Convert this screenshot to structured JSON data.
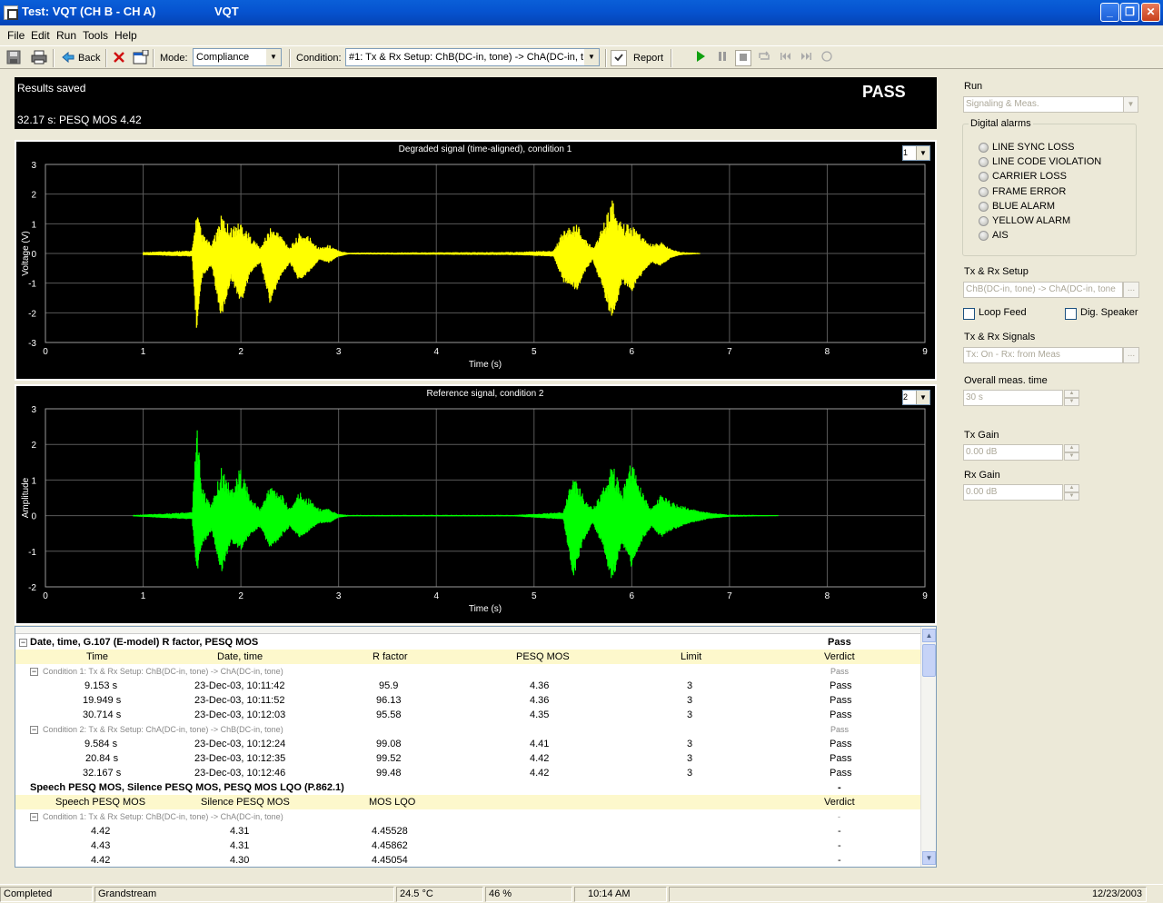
{
  "window": {
    "title": "Test: VQT (CH B - CH A)",
    "subtitle": "VQT",
    "min_glyph": "_",
    "restore_glyph": "❐",
    "close_glyph": "✕"
  },
  "menu": [
    "File",
    "Edit",
    "Run",
    "Tools",
    "Help"
  ],
  "toolbar": {
    "back_label": "Back",
    "mode_label": "Mode:",
    "mode_value": "Compliance",
    "condition_label": "Condition:",
    "condition_value": "#1: Tx & Rx Setup: ChB(DC-in, tone) -> ChA(DC-in, t",
    "report_label": "Report",
    "icons": [
      "save-icon",
      "print-icon",
      "back-arrow-icon",
      "delete-icon",
      "properties-icon",
      "check-icon",
      "play-icon",
      "pause-icon",
      "stop-icon",
      "loop-icon",
      "rewind-icon",
      "fast-forward-icon",
      "record-icon"
    ]
  },
  "status": {
    "message": "Results saved",
    "measurement": "32.17 s:  PESQ MOS  4.42",
    "verdict": "PASS"
  },
  "chart_data": [
    {
      "type": "line",
      "title": "Degraded signal (time-aligned), condition 1",
      "xlabel": "Time (s)",
      "ylabel": "Voltage (V)",
      "xlim": [
        0,
        9
      ],
      "ylim": [
        -3,
        3
      ],
      "x_ticks": [
        "0",
        "1",
        "2",
        "3",
        "4",
        "5",
        "6",
        "7",
        "8",
        "9"
      ],
      "y_ticks": [
        "3",
        "2",
        "1",
        "0",
        "-1",
        "-2",
        "-3"
      ],
      "color": "#ffff00",
      "selector": "1",
      "envelope": {
        "x": [
          1.0,
          1.5,
          1.55,
          1.6,
          1.7,
          1.8,
          1.9,
          2.0,
          2.1,
          2.2,
          2.3,
          2.4,
          2.5,
          2.6,
          2.7,
          2.8,
          2.9,
          3.0,
          3.1,
          4.8,
          5.2,
          5.3,
          5.45,
          5.5,
          5.6,
          5.7,
          5.8,
          5.9,
          6.0,
          6.1,
          6.2,
          6.3,
          6.4,
          6.5,
          6.7
        ],
        "upper": [
          0.05,
          0.1,
          1.5,
          0.7,
          0.3,
          1.3,
          0.9,
          1.1,
          0.6,
          0.2,
          0.9,
          0.7,
          0.2,
          0.7,
          0.6,
          0.2,
          0.3,
          0.1,
          0.03,
          0.05,
          0.1,
          0.8,
          1.0,
          0.6,
          0.2,
          0.9,
          1.8,
          1.0,
          1.0,
          0.6,
          0.3,
          0.4,
          0.15,
          0.05,
          0.02
        ],
        "lower": [
          -0.05,
          -0.1,
          -2.6,
          -0.8,
          -0.4,
          -2.1,
          -0.8,
          -1.6,
          -0.6,
          -0.3,
          -1.6,
          -0.8,
          -0.3,
          -0.9,
          -0.6,
          -0.2,
          -0.3,
          -0.1,
          -0.03,
          -0.05,
          -0.1,
          -0.9,
          -1.2,
          -0.7,
          -0.2,
          -1.1,
          -2.2,
          -0.9,
          -1.2,
          -0.7,
          -0.3,
          -0.4,
          -0.15,
          -0.05,
          -0.02
        ]
      }
    },
    {
      "type": "line",
      "title": "Reference signal, condition 2",
      "xlabel": "Time (s)",
      "ylabel": "Amplitude",
      "xlim": [
        0,
        9
      ],
      "ylim": [
        -2,
        3
      ],
      "x_ticks": [
        "0",
        "1",
        "2",
        "3",
        "4",
        "5",
        "6",
        "7",
        "8",
        "9"
      ],
      "y_ticks": [
        "3",
        "2",
        "1",
        "0",
        "-1",
        "-2"
      ],
      "color": "#00ff00",
      "selector": "2",
      "envelope": {
        "x": [
          0.9,
          1.5,
          1.55,
          1.6,
          1.7,
          1.8,
          1.9,
          2.0,
          2.1,
          2.2,
          2.3,
          2.4,
          2.5,
          2.6,
          2.7,
          2.8,
          2.9,
          3.0,
          3.1,
          4.8,
          5.3,
          5.4,
          5.5,
          5.6,
          5.7,
          5.8,
          5.9,
          6.0,
          6.1,
          6.2,
          6.3,
          6.4,
          6.6,
          6.8,
          7.0,
          7.5
        ],
        "upper": [
          0.02,
          0.1,
          2.6,
          0.8,
          0.3,
          1.4,
          0.8,
          1.4,
          0.5,
          0.2,
          0.9,
          0.7,
          0.2,
          0.7,
          0.5,
          0.2,
          0.2,
          0.05,
          0.02,
          0.02,
          0.1,
          1.2,
          0.6,
          0.2,
          0.7,
          1.5,
          0.7,
          1.6,
          0.7,
          0.2,
          0.6,
          0.4,
          0.2,
          0.08,
          0.03,
          0.01
        ],
        "lower": [
          -0.02,
          -0.1,
          -1.6,
          -0.8,
          -0.4,
          -1.5,
          -0.7,
          -0.9,
          -0.5,
          -0.3,
          -0.9,
          -0.6,
          -0.3,
          -0.6,
          -0.4,
          -0.2,
          -0.2,
          -0.05,
          -0.02,
          -0.02,
          -0.1,
          -1.7,
          -0.7,
          -0.2,
          -0.8,
          -1.8,
          -0.7,
          -1.4,
          -0.7,
          -0.3,
          -0.6,
          -0.4,
          -0.2,
          -0.08,
          -0.03,
          -0.01
        ]
      }
    }
  ],
  "results": {
    "section1": {
      "title": "Date, time, G.107 (E-model) R factor, PESQ MOS",
      "pass": "Pass",
      "columns": [
        "Time",
        "Date, time",
        "R factor",
        "PESQ MOS",
        "Limit",
        "Verdict"
      ],
      "groups": [
        {
          "condition": "Condition 1: Tx & Rx Setup: ChB(DC-in, tone) -> ChA(DC-in, tone)",
          "verdict": "Pass",
          "rows": [
            [
              "9.153 s",
              "23-Dec-03, 10:11:42",
              "95.9",
              "4.36",
              "3",
              "Pass"
            ],
            [
              "19.949 s",
              "23-Dec-03, 10:11:52",
              "96.13",
              "4.36",
              "3",
              "Pass"
            ],
            [
              "30.714 s",
              "23-Dec-03, 10:12:03",
              "95.58",
              "4.35",
              "3",
              "Pass"
            ]
          ]
        },
        {
          "condition": "Condition 2: Tx & Rx Setup: ChA(DC-in, tone) -> ChB(DC-in, tone)",
          "verdict": "Pass",
          "rows": [
            [
              "9.584 s",
              "23-Dec-03, 10:12:24",
              "99.08",
              "4.41",
              "3",
              "Pass"
            ],
            [
              "20.84 s",
              "23-Dec-03, 10:12:35",
              "99.52",
              "4.42",
              "3",
              "Pass"
            ],
            [
              "32.167 s",
              "23-Dec-03, 10:12:46",
              "99.48",
              "4.42",
              "3",
              "Pass"
            ]
          ]
        }
      ]
    },
    "section2": {
      "title": "Speech PESQ MOS, Silence PESQ MOS, PESQ MOS LQO (P.862.1)",
      "pass": "-",
      "columns": [
        "Speech PESQ MOS",
        "Silence PESQ MOS",
        "MOS LQO",
        "Verdict"
      ],
      "groups": [
        {
          "condition": "Condition 1: Tx & Rx Setup: ChB(DC-in, tone) -> ChA(DC-in, tone)",
          "verdict": "-",
          "rows": [
            [
              "4.42",
              "4.31",
              "4.45528",
              "-"
            ],
            [
              "4.43",
              "4.31",
              "4.45862",
              "-"
            ],
            [
              "4.42",
              "4.30",
              "4.45054",
              "-"
            ]
          ]
        }
      ]
    }
  },
  "right_panel": {
    "run_label": "Run",
    "run_value": "Signaling & Meas.",
    "alarms_title": "Digital alarms",
    "alarms": [
      "LINE SYNC LOSS",
      "LINE CODE VIOLATION",
      "CARRIER LOSS",
      "FRAME ERROR",
      "BLUE ALARM",
      "YELLOW ALARM",
      "AIS"
    ],
    "setup_label": "Tx & Rx Setup",
    "setup_value": "ChB(DC-in, tone) -> ChA(DC-in, tone",
    "loop_feed": "Loop Feed",
    "dig_speaker": "Dig. Speaker",
    "signals_label": "Tx & Rx Signals",
    "signals_value": "Tx: On - Rx: from Meas",
    "meas_time_label": "Overall meas. time",
    "meas_time_value": "30 s",
    "tx_gain_label": "Tx Gain",
    "tx_gain_value": "0.00 dB",
    "rx_gain_label": "Rx Gain",
    "rx_gain_value": "0.00 dB",
    "ellipsis": "..."
  },
  "statusbar": {
    "state": "Completed",
    "device": "Grandstream",
    "temperature": "24.5 °C",
    "humidity": "46 %",
    "time": "10:14 AM",
    "date": "12/23/2003"
  }
}
